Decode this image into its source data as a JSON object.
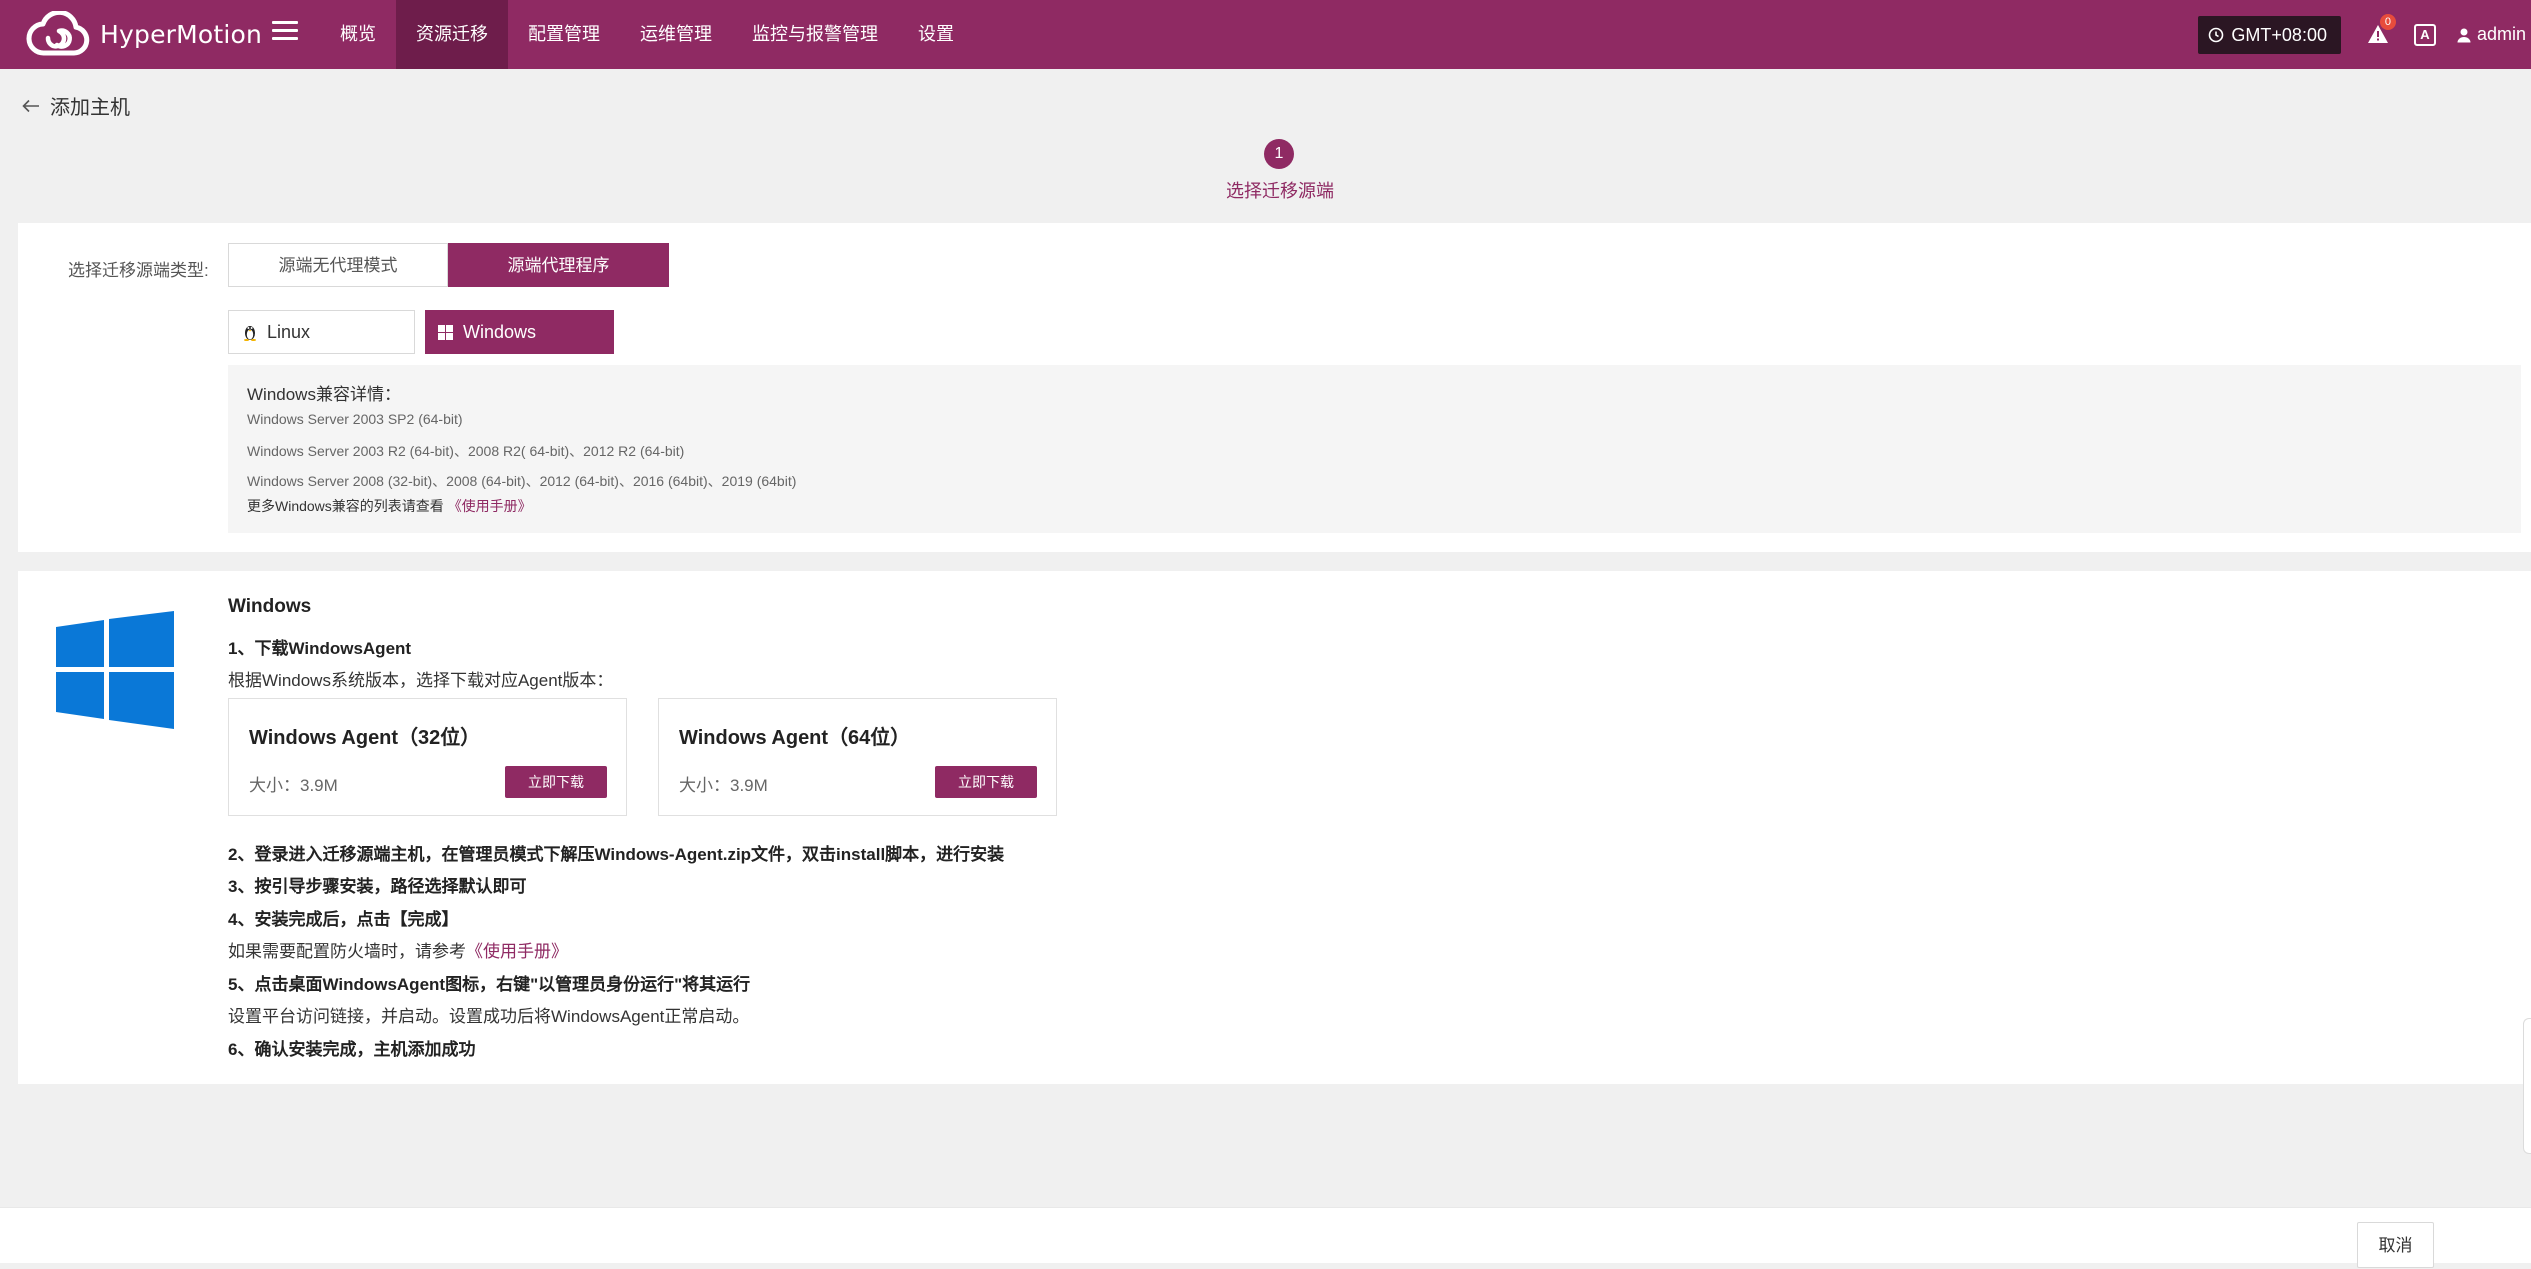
{
  "app": {
    "name": "HyperMotion"
  },
  "nav": {
    "items": [
      {
        "label": "概览"
      },
      {
        "label": "资源迁移",
        "active": true
      },
      {
        "label": "配置管理"
      },
      {
        "label": "运维管理"
      },
      {
        "label": "监控与报警管理"
      },
      {
        "label": "设置"
      }
    ]
  },
  "header_tools": {
    "timezone": "GMT+08:00",
    "alert_count": "0",
    "lang_icon_text": "A",
    "username": "admin"
  },
  "page": {
    "title": "添加主机"
  },
  "steps": [
    {
      "number": "1",
      "label": "选择迁移源端",
      "active": true
    }
  ],
  "source": {
    "type_label": "选择迁移源端类型:",
    "modes": [
      {
        "label": "源端无代理模式",
        "selected": false
      },
      {
        "label": "源端代理程序",
        "selected": true
      }
    ],
    "os_options": [
      {
        "label": "Linux",
        "icon": "linux-icon",
        "selected": false
      },
      {
        "label": "Windows",
        "icon": "windows-icon",
        "selected": true
      }
    ],
    "compat": {
      "title": "Windows兼容详情：",
      "lines": [
        "Windows Server 2003 SP2 (64-bit)",
        "Windows Server 2003 R2 (64-bit)、2008 R2( 64-bit)、2012 R2 (64-bit)",
        "Windows Server 2008 (32-bit)、2008 (64-bit)、2012 (64-bit)、2016 (64bit)、2019 (64bit)"
      ],
      "more_text": "更多Windows兼容的列表请查看",
      "manual_link": "《使用手册》"
    }
  },
  "install": {
    "title": "Windows",
    "step1": "1、下载WindowsAgent",
    "step1_desc": "根据Windows系统版本，选择下载对应Agent版本：",
    "agents": [
      {
        "title": "Windows Agent（32位）",
        "size_label": "大小：",
        "size": "3.9M",
        "button": "立即下载"
      },
      {
        "title": "Windows Agent（64位）",
        "size_label": "大小：",
        "size": "3.9M",
        "button": "立即下载"
      }
    ],
    "step2": "2、登录进入迁移源端主机，在管理员模式下解压Windows-Agent.zip文件，双击install脚本，进行安装",
    "step3": "3、按引导步骤安装，路径选择默认即可",
    "step4": "4、安装完成后，点击【完成】",
    "firewall_text": "如果需要配置防火墙时，请参考",
    "firewall_link": "《使用手册》",
    "step5": "5、点击桌面WindowsAgent图标，右键\"以管理员身份运行\"将其运行",
    "step5_desc": "设置平台访问链接，并启动。设置成功后将WindowsAgent正常启动。",
    "step6": "6、确认安装完成，主机添加成功"
  },
  "footer": {
    "cancel": "取消"
  },
  "colors": {
    "brand": "#8f2a63",
    "brand_dark": "#6e1d4b",
    "windows_blue": "#0a78d7"
  }
}
